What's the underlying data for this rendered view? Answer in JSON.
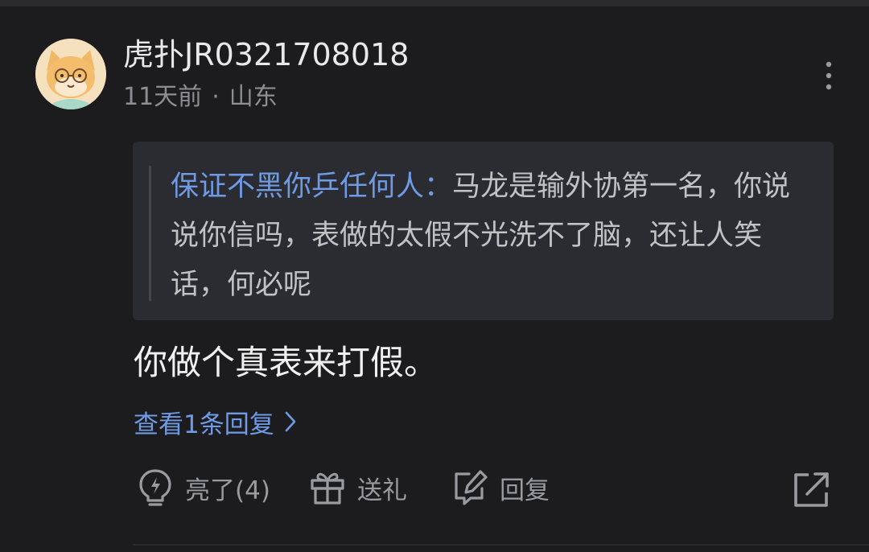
{
  "comment": {
    "username": "虎扑JR0321708018",
    "time": "11天前",
    "separator": "·",
    "location": "山东",
    "quote": {
      "author": "保证不黑你乒任何人：",
      "text": "马龙是输外协第一名，你说说你信吗，表做的太假不光洗不了脑，还让人笑话，何必呢"
    },
    "body": "你做个真表来打假。",
    "view_replies_label": "查看1条回复"
  },
  "actions": {
    "like_label": "亮了(4)",
    "gift_label": "送礼",
    "reply_label": "回复"
  },
  "icons": {
    "avatar": "avatar",
    "more": "more-vertical-icon",
    "chevron": "chevron-right-icon",
    "like": "lightbulb-icon",
    "gift": "gift-icon",
    "reply": "edit-reply-icon",
    "share": "share-external-icon"
  },
  "colors": {
    "background": "#1c1c1e",
    "quote_background": "#2b2c31",
    "link_blue": "#6f9ae6",
    "muted_text": "#8d8e93"
  }
}
